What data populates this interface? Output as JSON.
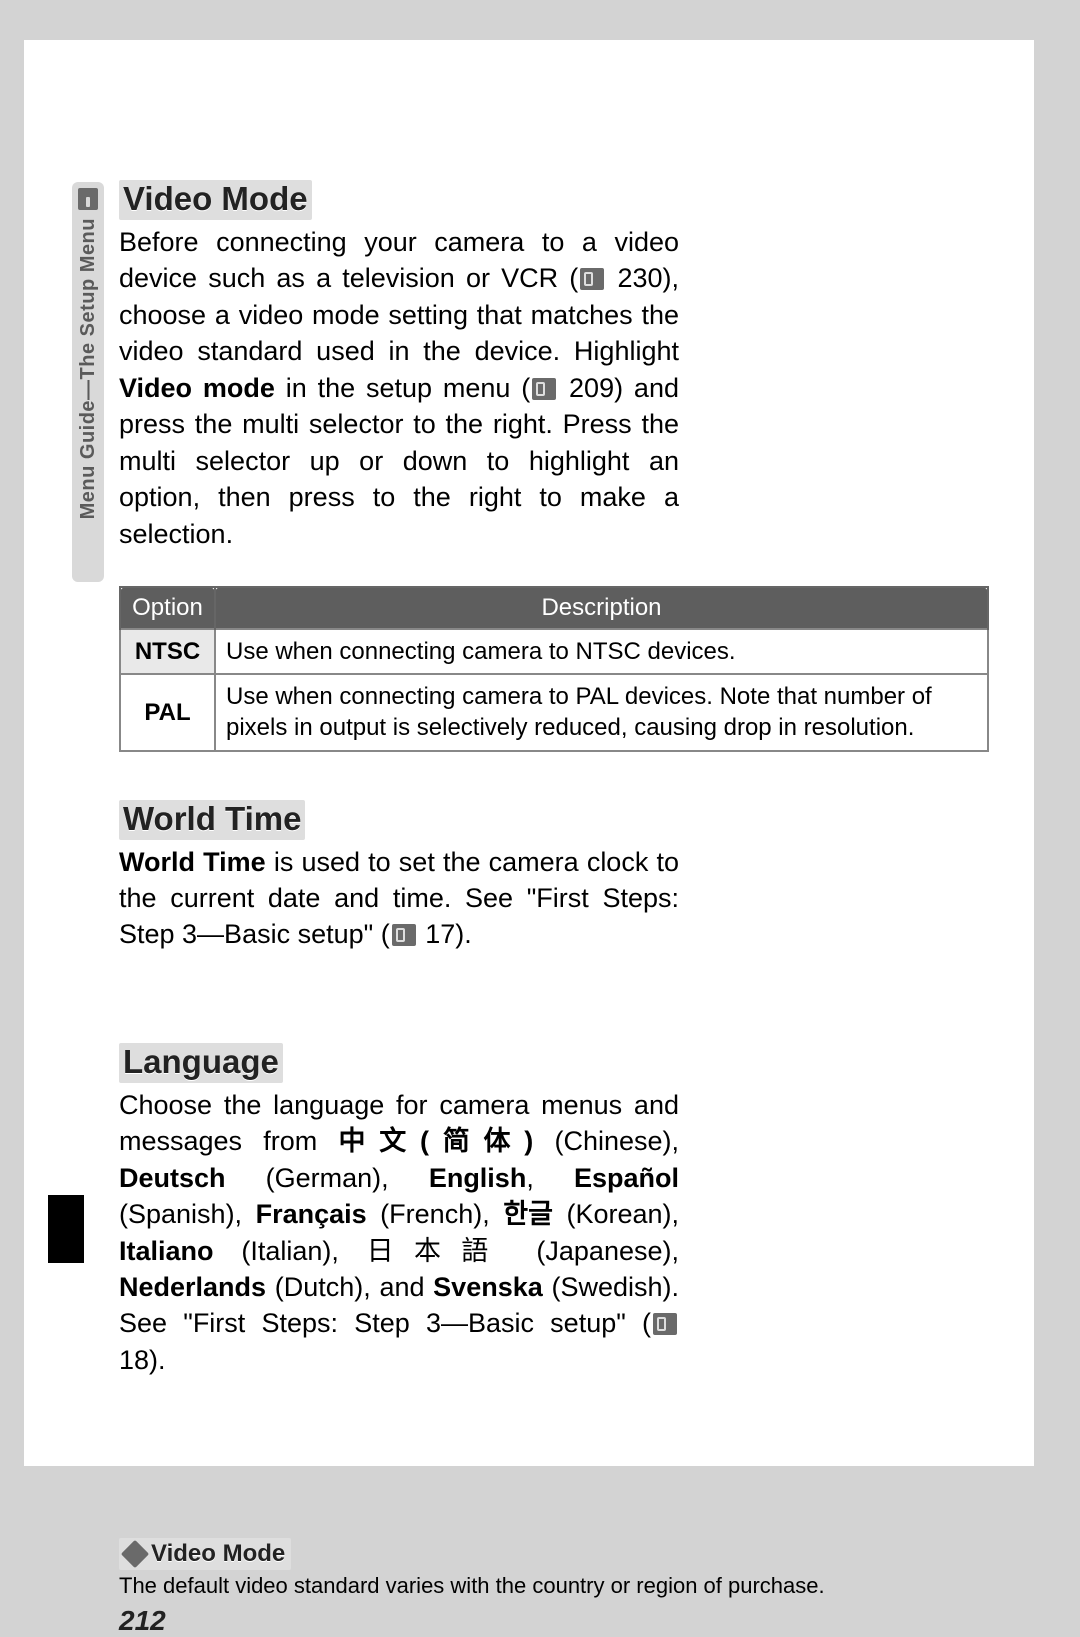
{
  "side_tab": {
    "label": "Menu Guide—The Setup Menu"
  },
  "sections": {
    "video_mode": {
      "heading": "Video Mode",
      "para_before_ref1": "Before connecting your camera to a video device such as a television or VCR (",
      "ref1_num": " 230",
      "para_mid1": "), choose a video mode setting that matches the video standard used in the device.  Highlight ",
      "bold1": "Video mode",
      "para_mid2": " in the setup menu (",
      "ref2_num": " 209",
      "para_after": ") and press the multi selector to the right.  Press the multi selector up or down to highlight an option, then press to the right to make a selection.",
      "table": {
        "head_option": "Option",
        "head_description": "Description",
        "rows": [
          {
            "option": "NTSC",
            "desc": "Use when connecting camera to NTSC devices."
          },
          {
            "option": "PAL",
            "desc": "Use when connecting camera to PAL devices.  Note that number of pixels in output is selectively reduced, causing drop in resolution."
          }
        ]
      }
    },
    "world_time": {
      "heading": "World Time",
      "bold_lead": "World Time",
      "para1": " is used to set the camera clock to the current date and time.  See \"First Steps: Step 3—Basic setup\" (",
      "ref_num": " 17",
      "para2": ")."
    },
    "language": {
      "heading": "Language",
      "t1": "Choose the language for camera menus and messages from ",
      "b1": "中文(简体)",
      "t2": " (Chinese), ",
      "b2": "Deutsch",
      "t3": " (German), ",
      "b3": "English",
      "t4": ", ",
      "b4": "Español",
      "t5": " (Spanish), ",
      "b5": "Français",
      "t6": " (French), ",
      "b6": "한글",
      "t7": " (Korean), ",
      "b7": "Italiano",
      "t8": " (Italian), 日本語 (Japanese), ",
      "b8": "Nederlands",
      "t9": " (Dutch), and ",
      "b9": "Svenska",
      "t10": " (Swedish).  See \"First Steps: Step 3—Basic setup\" (",
      "ref_num": " 18",
      "t11": ")."
    }
  },
  "note": {
    "title": "Video Mode",
    "text": "The default video standard varies with the country or region of purchase."
  },
  "page_number": "212"
}
